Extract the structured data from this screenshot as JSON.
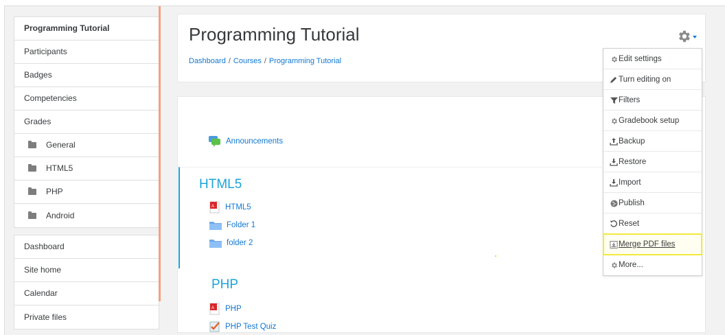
{
  "sidebar": {
    "course_block": [
      {
        "label": "Programming Tutorial",
        "bold": true
      },
      {
        "label": "Participants"
      },
      {
        "label": "Badges"
      },
      {
        "label": "Competencies"
      },
      {
        "label": "Grades"
      },
      {
        "label": "General",
        "icon": "folder-icon"
      },
      {
        "label": "HTML5",
        "icon": "folder-icon"
      },
      {
        "label": "PHP",
        "icon": "folder-icon"
      },
      {
        "label": "Android",
        "icon": "folder-icon"
      }
    ],
    "site_block": [
      {
        "label": "Dashboard"
      },
      {
        "label": "Site home"
      },
      {
        "label": "Calendar"
      },
      {
        "label": "Private files"
      }
    ]
  },
  "header": {
    "title": "Programming Tutorial",
    "breadcrumb": [
      "Dashboard",
      "Courses",
      "Programming Tutorial"
    ],
    "breadcrumb_separator": "/",
    "actions_icon": "gear-icon"
  },
  "content": {
    "general_activities": [
      {
        "label": "Announcements",
        "icon": "forum-icon"
      }
    ],
    "sections": [
      {
        "title": "HTML5",
        "activities": [
          {
            "label": "HTML5",
            "icon": "pdf-icon"
          },
          {
            "label": "Folder 1",
            "icon": "folder-icon"
          },
          {
            "label": "folder 2",
            "icon": "folder-icon"
          }
        ]
      },
      {
        "title": "PHP",
        "activities": [
          {
            "label": "PHP",
            "icon": "pdf-icon"
          },
          {
            "label": "PHP Test Quiz",
            "icon": "quiz-icon"
          }
        ]
      }
    ]
  },
  "actions_menu": {
    "items": [
      {
        "label": "Edit settings",
        "icon": "gear-icon"
      },
      {
        "label": "Turn editing on",
        "icon": "pencil-icon"
      },
      {
        "label": "Filters",
        "icon": "filter-icon"
      },
      {
        "label": "Gradebook setup",
        "icon": "gear-icon"
      },
      {
        "label": "Backup",
        "icon": "upload-icon"
      },
      {
        "label": "Restore",
        "icon": "download-icon"
      },
      {
        "label": "Import",
        "icon": "download-icon"
      },
      {
        "label": "Publish",
        "icon": "globe-icon"
      },
      {
        "label": "Reset",
        "icon": "reset-icon"
      },
      {
        "label": "Merge PDF files",
        "icon": "merge-pdf-icon",
        "highlighted": true
      },
      {
        "label": "More...",
        "icon": "gear-icon"
      }
    ]
  },
  "colors": {
    "link": "#1177d1",
    "section_title": "#1ba3d8",
    "highlight_outline": "#f1ea3c",
    "drawer_edge": "#f0a27f"
  }
}
